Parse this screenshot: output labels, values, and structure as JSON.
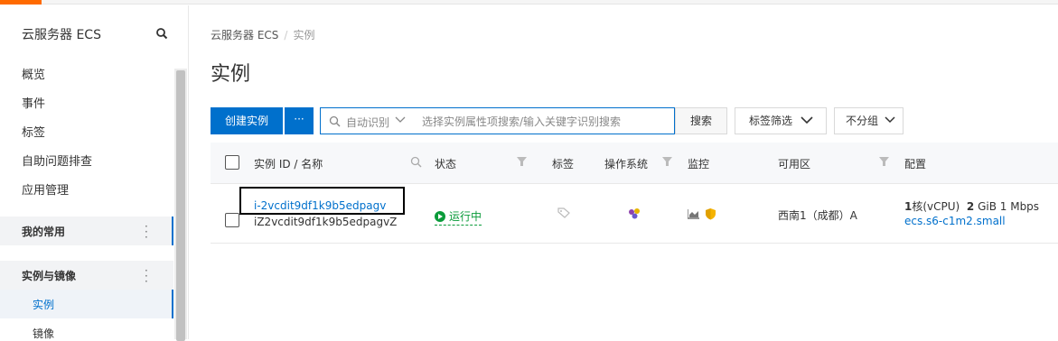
{
  "sidebar": {
    "title": "云服务器 ECS",
    "items": [
      {
        "label": "概览"
      },
      {
        "label": "事件"
      },
      {
        "label": "标签"
      },
      {
        "label": "自助问题排查"
      },
      {
        "label": "应用管理"
      }
    ],
    "groups": [
      {
        "label": "我的常用"
      },
      {
        "label": "实例与镜像"
      }
    ],
    "sub_items": [
      {
        "label": "实例"
      },
      {
        "label": "镜像"
      }
    ]
  },
  "breadcrumb": {
    "root": "云服务器 ECS",
    "separator": "/",
    "current": "实例"
  },
  "page_title": "实例",
  "toolbar": {
    "create_label": "创建实例",
    "more_label": "···",
    "search_mode": "自动识别",
    "search_placeholder": "选择实例属性项搜索/输入关键字识别搜索",
    "search_label": "搜索",
    "tag_filter_label": "标签筛选",
    "group_label": "不分组"
  },
  "table": {
    "headers": {
      "id_name": "实例 ID / 名称",
      "status": "状态",
      "tags": "标签",
      "os": "操作系统",
      "monitor": "监控",
      "zone": "可用区",
      "config": "配置"
    },
    "rows": [
      {
        "id": "i-2vcdit9df1k9b5edpagv",
        "name": "iZ2vcdit9df1k9b5edpagvZ",
        "status": "运行中",
        "zone": "西南1（成都）A",
        "cpu_value": "1",
        "cpu_unit": "核(vCPU)",
        "mem_value": "2",
        "mem_unit": "GiB",
        "bandwidth": "1 Mbps",
        "instance_type": "ecs.s6-c1m2.small"
      }
    ]
  },
  "colors": {
    "primary": "#0070cc",
    "running": "#0a9b3a",
    "brand": "#ff6a00"
  }
}
